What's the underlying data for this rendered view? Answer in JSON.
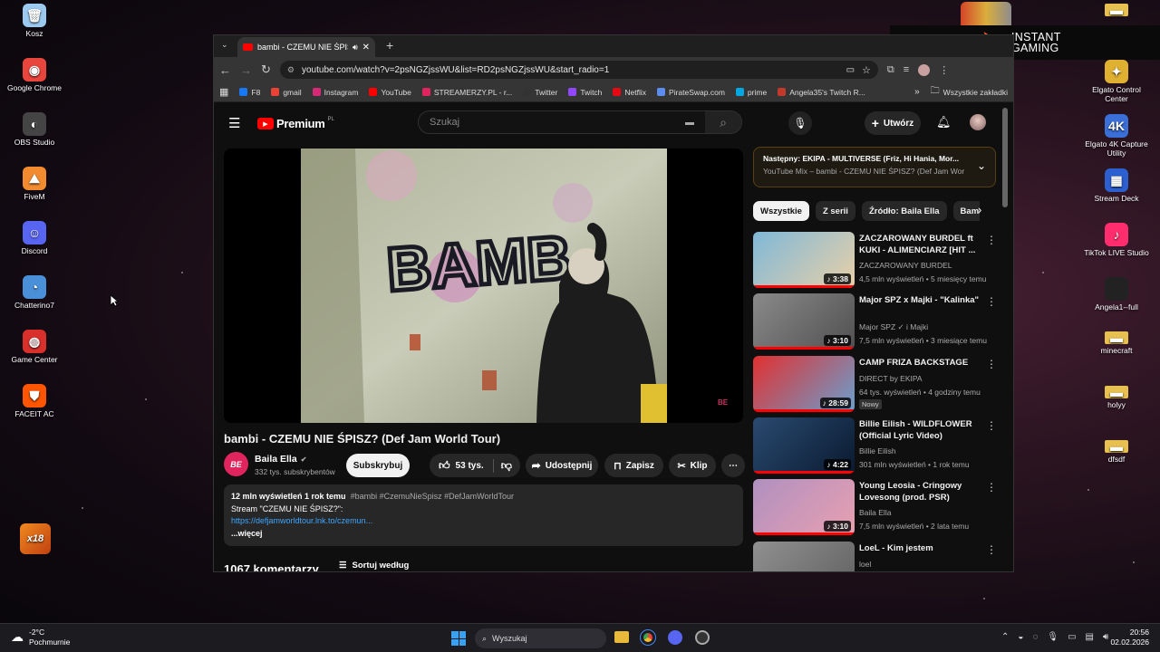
{
  "desktop": {
    "left_icons": [
      {
        "label": "Kosz",
        "icon": "recycle-bin-icon",
        "color": "#9cc9f0",
        "glyph": "🗑"
      },
      {
        "label": "Google Chrome",
        "icon": "chrome-icon",
        "color": "#e8453c",
        "glyph": "◉"
      },
      {
        "label": "OBS Studio",
        "icon": "obs-icon",
        "color": "#444",
        "glyph": "◐"
      },
      {
        "label": "FiveM",
        "icon": "fivem-icon",
        "color": "#f28b30",
        "glyph": "⛰"
      },
      {
        "label": "Discord",
        "icon": "discord-icon",
        "color": "#5865f2",
        "glyph": "☺"
      },
      {
        "label": "Chatterino7",
        "icon": "chatterino-icon",
        "color": "#4a90d9",
        "glyph": "◔"
      },
      {
        "label": "Game Center",
        "icon": "game-center-icon",
        "color": "#d9302c",
        "glyph": "◍"
      },
      {
        "label": "FACEIT AC",
        "icon": "faceit-icon",
        "color": "#ff5500",
        "glyph": "⛊"
      }
    ],
    "right_icons": [
      {
        "label": "",
        "icon": "folder-icon",
        "color": "#e8c050",
        "glyph": "▬"
      },
      {
        "label": "Elgato Control Center",
        "icon": "elgato-control-icon",
        "color": "#e0b030",
        "glyph": "✦"
      },
      {
        "label": "Elgato 4K Capture Utility",
        "icon": "elgato-4k-icon",
        "color": "#3a6fd8",
        "glyph": "4K"
      },
      {
        "label": "Stream Deck",
        "icon": "stream-deck-icon",
        "color": "#2c5fd0",
        "glyph": "▦"
      },
      {
        "label": "TikTok LIVE Studio",
        "icon": "tiktok-icon",
        "color": "#ff2d6e",
        "glyph": "♪"
      },
      {
        "label": "Angela1--full",
        "icon": "file-icon",
        "color": "#222",
        "glyph": ""
      },
      {
        "label": "minecraft",
        "icon": "folder-icon",
        "color": "#e8c050",
        "glyph": "▬"
      },
      {
        "label": "holyy",
        "icon": "folder-icon",
        "color": "#e8c050",
        "glyph": "▬"
      },
      {
        "label": "dfsdf",
        "icon": "folder-icon",
        "color": "#e8c050",
        "glyph": "▬"
      }
    ],
    "x18_label": "x18",
    "instant_gaming": {
      "line1": "INSTANT",
      "line2": "GAMING"
    }
  },
  "browser": {
    "tab_title": "bambi - CZEMU NIE ŚPISZ?",
    "url": "youtube.com/watch?v=2psNGZjssWU&list=RD2psNGZjssWU&start_radio=1",
    "bookmarks": [
      {
        "label": "F8",
        "color": "#1877f2"
      },
      {
        "label": "gmail",
        "color": "#ea4335"
      },
      {
        "label": "Instagram",
        "color": "#d62976"
      },
      {
        "label": "YouTube",
        "color": "#ff0000"
      },
      {
        "label": "STREAMERZY.PL - r...",
        "color": "#e0245e"
      },
      {
        "label": "Twitter",
        "color": "#333"
      },
      {
        "label": "Twitch",
        "color": "#9146ff"
      },
      {
        "label": "Netflix",
        "color": "#e50914"
      },
      {
        "label": "PirateSwap.com",
        "color": "#5a8dee"
      },
      {
        "label": "prime",
        "color": "#00a8e1"
      },
      {
        "label": "Angela35's Twitch R...",
        "color": "#c0392b"
      }
    ],
    "all_bookmarks": "Wszystkie zakładki"
  },
  "youtube": {
    "logo": "Premium",
    "logo_sup": "PL",
    "search_placeholder": "Szukaj",
    "create_label": "Utwórz",
    "video_title": "bambi - CZEMU NIE ŚPISZ? (Def Jam World Tour)",
    "channel_name": "Baila Ella",
    "channel_subs": "332 tys. subskrybentów",
    "channel_avatar_text": "BE",
    "subscribe_label": "Subskrybuj",
    "likes": "53 tys.",
    "share_label": "Udostępnij",
    "save_label": "Zapisz",
    "clip_label": "Klip",
    "desc_views": "12 mln wyświetleń  1 rok temu",
    "desc_tags": "#bambi #CzemuNieSpisz #DefJamWorldTour",
    "desc_line2": "Stream \"CZEMU NIE ŚPISZ?\":",
    "desc_link": "https://defjamworldtour.lnk.to/czemun...",
    "desc_more": "...więcej",
    "comments_count": "1067 komentarzy",
    "sort_label": "Sortuj według",
    "graffiti_text": "BAMB",
    "next_label": "Następny: EKIPA - MULTIVERSE (Friz, Hi Hania, Mor...",
    "next_sub": "YouTube Mix – bambi - CZEMU NIE ŚPISZ? (Def Jam World ...",
    "chips": [
      "Wszystkie",
      "Z serii",
      "Źródło: Baila Ella",
      "Bamb"
    ],
    "related": [
      {
        "title": "ZACZAROWANY BURDEL ft KUKI - ALIMENCIARZ [HIT ...",
        "channel": "ZACZAROWANY BURDEL",
        "meta": "4,5 mln wyświetleń • 5 miesięcy temu",
        "duration": "3:38",
        "thumb_a": "#7fb8d8",
        "thumb_b": "#e8d0a8",
        "badge": ""
      },
      {
        "title": "Major SPZ x Majki - \"Kalinka\"",
        "channel": "Major SPZ ✓ i Majki",
        "meta": "7,5 mln wyświetleń • 3 miesiące temu",
        "duration": "3:10",
        "thumb_a": "#8a8a8a",
        "thumb_b": "#505050",
        "badge": ""
      },
      {
        "title": "CAMP FRIZA BACKSTAGE",
        "channel": "DIRECT by EKIPA",
        "meta": "64 tys. wyświetleń • 4 godziny temu",
        "duration": "28:59",
        "thumb_a": "#e03030",
        "thumb_b": "#6aa0d0",
        "badge": "Nowy"
      },
      {
        "title": "Billie Eilish - WILDFLOWER (Official Lyric Video)",
        "channel": "Billie Eilish",
        "meta": "301 mln wyświetleń • 1 rok temu",
        "duration": "4:22",
        "thumb_a": "#2a4a70",
        "thumb_b": "#0a1a30",
        "badge": ""
      },
      {
        "title": "Young Leosia - Cringowy Lovesong (prod. PSR)",
        "channel": "Baila Ella",
        "meta": "7,5 mln wyświetleń • 2 lata temu",
        "duration": "3:10",
        "thumb_a": "#b090c0",
        "thumb_b": "#e8a0b0",
        "badge": ""
      },
      {
        "title": "LoeL - Kim jestem",
        "channel": "loel",
        "meta": "",
        "duration": "",
        "thumb_a": "#909090",
        "thumb_b": "#606060",
        "badge": ""
      }
    ]
  },
  "taskbar": {
    "weather_temp": "-2°C",
    "weather_desc": "Pochmurnie",
    "search_placeholder": "Wyszukaj",
    "time": "20:56",
    "date": "02.02.2026"
  }
}
